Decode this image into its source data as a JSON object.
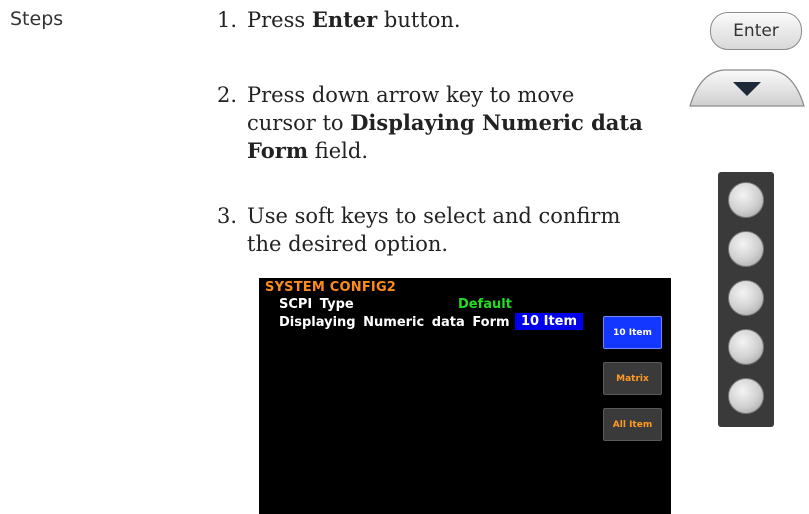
{
  "steps_label": "Steps",
  "steps": [
    {
      "number": "1.",
      "parts": {
        "pre": "Press ",
        "bold": "Enter",
        "post": " button."
      }
    },
    {
      "number": "2.",
      "lines": [
        "Press down arrow key to move",
        "cursor to ",
        "Displaying Numeric data",
        "Form",
        " field."
      ]
    },
    {
      "number": "3.",
      "lines": [
        "Use soft keys to select and confirm",
        "the desired option."
      ]
    }
  ],
  "enter_button": {
    "label": "Enter"
  },
  "down_arrow_key": {
    "icon": "down-arrow-icon"
  },
  "soft_keys_count": 5,
  "screen": {
    "title": "SYSTEM  CONFIG2",
    "rows": [
      {
        "label": "SCPI  Type",
        "value": "Default",
        "value_color": "#22dd22"
      },
      {
        "label": "Displaying  Numeric  data  Form",
        "value": "10  Item",
        "highlight": "#0000ee"
      }
    ],
    "soft_menu": [
      {
        "label": "10 Item",
        "active": true
      },
      {
        "label": "Matrix",
        "active": false
      },
      {
        "label": "All Item",
        "active": false
      }
    ]
  },
  "colors": {
    "title": "#ff8c1a",
    "selected_background": "#0000ee",
    "value_green": "#22dd22",
    "active_softkey": "#1437ff",
    "inactive_softkey_text": "#ff9a22"
  }
}
